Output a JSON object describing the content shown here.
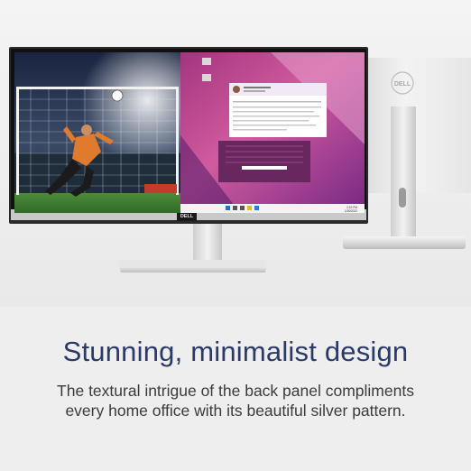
{
  "product": {
    "brand": "DELL",
    "headline": "Stunning, minimalist design",
    "description_lines": [
      "The textural intrigue of the back panel compliments",
      "every home office with its beautiful silver pattern."
    ]
  },
  "screen": {
    "window_title": "",
    "taskbar_time": "2:19 PM",
    "taskbar_date": "1/26/2022"
  },
  "colors": {
    "headline": "#2b3a67",
    "body": "#3b3b3b",
    "background": "#eeeeee",
    "wallpaper_magenta": "#c0418f",
    "wallpaper_purple": "#6b2a7a"
  }
}
